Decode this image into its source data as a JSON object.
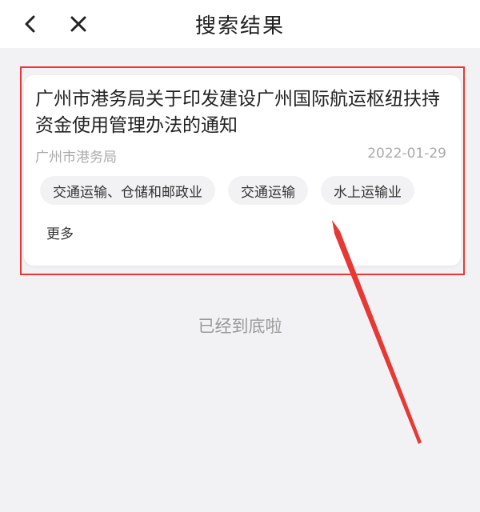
{
  "header": {
    "title": "搜索结果",
    "back_icon": "chevron-left-icon",
    "close_icon": "close-icon"
  },
  "result": {
    "title": "广州市港务局关于印发建设广州国际航运枢纽扶持资金使用管理办法的通知",
    "source": "广州市港务局",
    "date": "2022-01-29",
    "tags": [
      {
        "label": "交通运输、仓储和邮政业"
      },
      {
        "label": "交通运输"
      },
      {
        "label": "水上运输业"
      }
    ],
    "more_label": "更多"
  },
  "footer": {
    "end_text": "已经到底啦"
  },
  "colors": {
    "annotation": "#e53935",
    "background": "#f2f2f5",
    "tag_background": "#f2f2f4"
  }
}
